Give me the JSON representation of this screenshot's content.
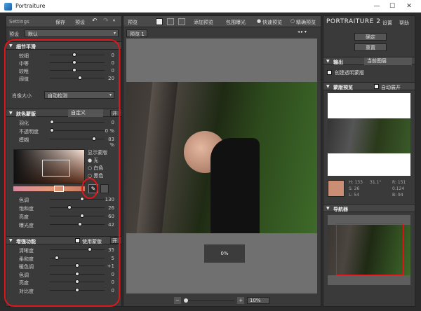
{
  "window": {
    "title": "Portraiture",
    "minimize": "—",
    "maximize": "☐",
    "close": "✕"
  },
  "top_left": {
    "settings": "Settings",
    "save": "保存",
    "reset": "预设"
  },
  "preset": {
    "label": "预设",
    "value": "默认"
  },
  "detail": {
    "title": "细节平滑",
    "sliders": [
      {
        "label": "较细",
        "value": "0",
        "pos": 0.45
      },
      {
        "label": "中等",
        "value": "0",
        "pos": 0.45
      },
      {
        "label": "较粗",
        "value": "0",
        "pos": 0.45
      },
      {
        "label": "阈值",
        "value": "20",
        "pos": 0.55
      }
    ],
    "size_label": "肖像大小",
    "size_value": "自动检测"
  },
  "mask": {
    "title": "肤色蒙版",
    "mode": "自定义",
    "toggle": "开",
    "sliders": [
      {
        "label": "羽化",
        "value": "0",
        "pos": 0.0
      },
      {
        "label": "不透明度",
        "value": "0 %",
        "pos": 0.0
      },
      {
        "label": "模糊",
        "value": "83 %",
        "pos": 0.83
      }
    ],
    "display_label": "显示蒙版",
    "display_options": [
      "无",
      "白色",
      "黑色"
    ],
    "color_sliders": [
      {
        "label": "色调",
        "value": "130",
        "pos": 0.6
      },
      {
        "label": "饱和度",
        "value": "26",
        "pos": 0.35
      },
      {
        "label": "亮度",
        "value": "60",
        "pos": 0.6
      },
      {
        "label": "曝光度",
        "value": "42",
        "pos": 0.55
      }
    ]
  },
  "enhance": {
    "title": "增强功能",
    "use_mask": "使用蒙版",
    "toggle": "开",
    "sliders": [
      {
        "label": "清晰度",
        "value": "35",
        "pos": 0.75
      },
      {
        "label": "柔和度",
        "value": "5",
        "pos": 0.1
      },
      {
        "label": "暖色调",
        "value": "+1",
        "pos": 0.5
      },
      {
        "label": "色调",
        "value": "0",
        "pos": 0.5
      },
      {
        "label": "亮度",
        "value": "0",
        "pos": 0.5
      },
      {
        "label": "对比度",
        "value": "0",
        "pos": 0.5
      }
    ]
  },
  "toolbar": {
    "preview": "预览",
    "add_preview": "添加预览",
    "clip": "包围曝光",
    "quick": "快速预览",
    "precise": "精确预览"
  },
  "preview_tab": "预览 1",
  "progress": "0%",
  "zoom": {
    "value": "10%"
  },
  "right": {
    "brand": "PORTRAITURE 2",
    "settings": "设置",
    "help": "帮助",
    "ok": "确定",
    "reset": "重置",
    "output_title": "输出",
    "output_value": "当前图层",
    "create_mask": "创建透明蒙版",
    "mask_preview_title": "蒙版预览",
    "auto_expand": "自动展开",
    "color_readout": {
      "h": "H: 133",
      "v1": "31.1°",
      "s": "S: 26",
      "v2": "0.124",
      "l": "L: 54",
      "v3": "B: 94",
      "r": "R: 151"
    },
    "navigator_title": "导航器"
  },
  "colors": {
    "accent_red": "#e0161a",
    "swatch": "#c98e73",
    "panel": "#3a3a3a"
  }
}
